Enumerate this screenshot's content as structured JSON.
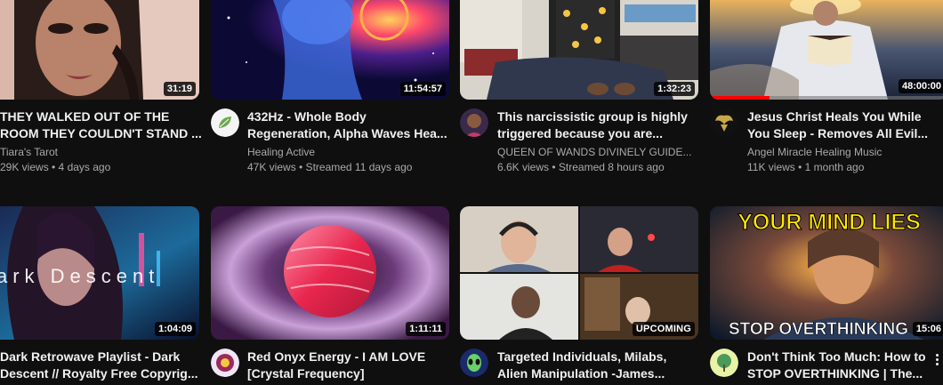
{
  "videos": [
    {
      "duration": "31:19",
      "title_line1": "THEY WALKED OUT OF THE",
      "title_line2": "ROOM THEY COULDN'T STAND ...",
      "channel": "Tiara's Tarot",
      "stats": "29K views • 4 days ago",
      "avatar_icon": "none"
    },
    {
      "duration": "11:54:57",
      "title_line1": "432Hz - Whole Body",
      "title_line2": "Regeneration, Alpha Waves Hea...",
      "channel": "Healing Active",
      "stats": "47K views • Streamed 11 days ago",
      "avatar_icon": "leaf-logo"
    },
    {
      "duration": "1:32:23",
      "title_line1": "This narcissistic group is highly",
      "title_line2": "triggered because you are...",
      "channel": "QUEEN OF WANDS DIVINELY GUIDE...",
      "stats": "6.6K views • Streamed 8 hours ago",
      "avatar_icon": "woman-portrait"
    },
    {
      "duration": "48:00:00",
      "watch_progress": 0.25,
      "title_line1": "Jesus Christ Heals You While",
      "title_line2": "You Sleep - Removes All Evil...",
      "channel": "Angel Miracle Healing Music",
      "stats": "11K views • 1 month ago",
      "avatar_icon": "angel-wings-logo"
    },
    {
      "duration": "1:04:09",
      "thumb_text": "ark Descent",
      "title_line1": "Dark Retrowave Playlist - Dark",
      "title_line2": "Descent // Royalty Free Copyrig...",
      "avatar_icon": "none"
    },
    {
      "duration": "1:11:11",
      "title_line1": "Red Onyx Energy - I AM LOVE",
      "title_line2": "[Crystal Frequency]",
      "avatar_icon": "mandala-logo"
    },
    {
      "duration": "UPCOMING",
      "title_line1": "Targeted Individuals, Milabs,",
      "title_line2": "Alien Manipulation -James...",
      "avatar_icon": "alien-logo"
    },
    {
      "duration": "15:06",
      "thumb_text_top": "YOUR MIND LIES",
      "thumb_text_bottom": "STOP OVERTHINKING",
      "title_line1": "Don't Think Too Much: How to",
      "title_line2": "STOP OVERTHINKING | The...",
      "avatar_icon": "tree-logo"
    }
  ]
}
